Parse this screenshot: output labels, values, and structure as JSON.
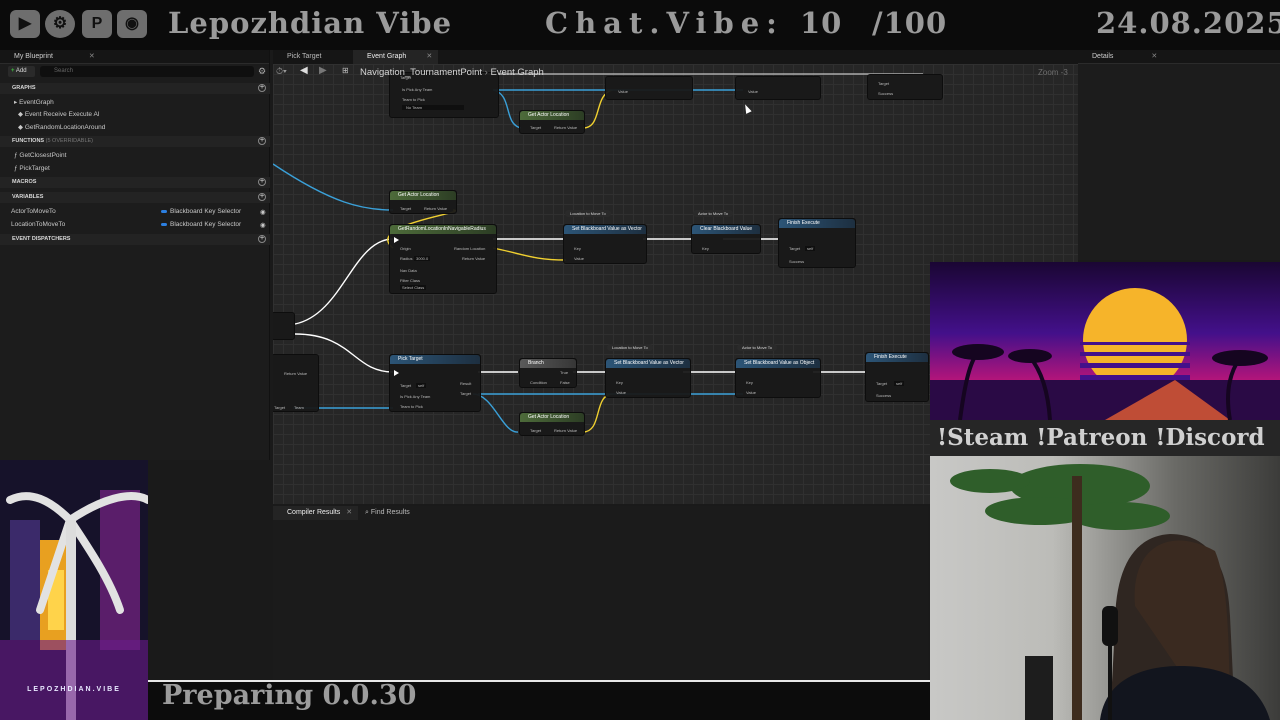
{
  "overlay": {
    "channel_name": "Lepozhdian Vibe",
    "chat_vibe_label": "Chat.Vibe:",
    "chat_vibe_value": "10",
    "chat_vibe_max": "/100",
    "date": "24.08.2025",
    "socials": "!Steam !Patreon !Discord",
    "brand_label": "LEPOZHDIAN.VIBE",
    "status_text": "Preparing 0.0.30"
  },
  "left_panel": {
    "tab_title": "My Blueprint",
    "add_label": "Add",
    "search_placeholder": "Search",
    "graphs_header": "GRAPHS",
    "graphs": [
      "EventGraph",
      "Event Receive Execute AI",
      "GetRandomLocationAround"
    ],
    "functions_header": "FUNCTIONS",
    "functions_overridable": "(5 OVERRIDABLE)",
    "functions": [
      "GetClosestPoint",
      "PickTarget"
    ],
    "macros_header": "MACROS",
    "variables_header": "VARIABLES",
    "variables": [
      {
        "name": "ActorToMoveTo",
        "type": "Blackboard Key Selector"
      },
      {
        "name": "LocationToMoveTo",
        "type": "Blackboard Key Selector"
      }
    ],
    "dispatchers_header": "EVENT DISPATCHERS"
  },
  "editor": {
    "tabs": [
      "Pick Target",
      "Event Graph"
    ],
    "breadcrumb_root": "Navigation_TournamentPoint",
    "breadcrumb_current": "Event Graph",
    "zoom": "Zoom -3",
    "details_tab": "Details",
    "bottom_tabs": [
      "Compiler Results",
      "Find Results"
    ]
  },
  "nodes": {
    "get_actor_location_1": {
      "title": "Get Actor Location",
      "target": "Target",
      "ret": "Return Value"
    },
    "get_random_location": {
      "title": "GetRandomLocationInNavigableRadius",
      "origin": "Origin",
      "radius": "Radius",
      "radius_value": "3000.0",
      "nav_data": "Nav Data",
      "filter_class": "Filter Class",
      "filter_value": "Select Class",
      "random_location": "Random Location",
      "ret": "Return Value"
    },
    "set_bb_vector_1": {
      "title": "Set Blackboard Value as Vector",
      "key": "Key",
      "value": "Value"
    },
    "var_location_1": "Location to Move To",
    "var_actor_1": "Actor to Move To",
    "clear_bb": {
      "title": "Clear Blackboard Value",
      "key": "Key"
    },
    "finish_execute_1": {
      "title": "Finish Execute",
      "target": "Target",
      "self": "self",
      "success": "Success"
    },
    "pick_target": {
      "title": "Pick Target",
      "target": "Target",
      "self": "self",
      "is_pick_any": "Is Pick Any Team",
      "team_to_pick": "Team to Pick",
      "result": "Result",
      "target_out": "Target"
    },
    "branch": {
      "title": "Branch",
      "condition": "Condition",
      "true": "True",
      "false": "False"
    },
    "var_location_2": "Location to Move To",
    "set_bb_vector_2": {
      "title": "Set Blackboard Value as Vector",
      "key": "Key",
      "value": "Value"
    },
    "var_actor_2": "Actor to Move To",
    "set_bb_object": {
      "title": "Set Blackboard Value as Object",
      "key": "Key",
      "value": "Value"
    },
    "finish_execute_2": {
      "title": "Finish Execute",
      "target": "Target",
      "self": "self",
      "success": "Success"
    },
    "get_actor_location_2": {
      "title": "Get Actor Location",
      "target": "Target",
      "ret": "Return Value"
    },
    "get_actor_location_top": {
      "title": "Get Actor Location",
      "target": "Target",
      "ret": "Return Value"
    },
    "top_pick": {
      "target": "Target",
      "self": "self",
      "is_pick_any": "Is Pick Any Team",
      "team_to_pick": "Team to Pick",
      "team_value": "No Team"
    },
    "left_partial": {
      "return_value": "Return Value",
      "target": "Target",
      "team": "Team"
    }
  }
}
